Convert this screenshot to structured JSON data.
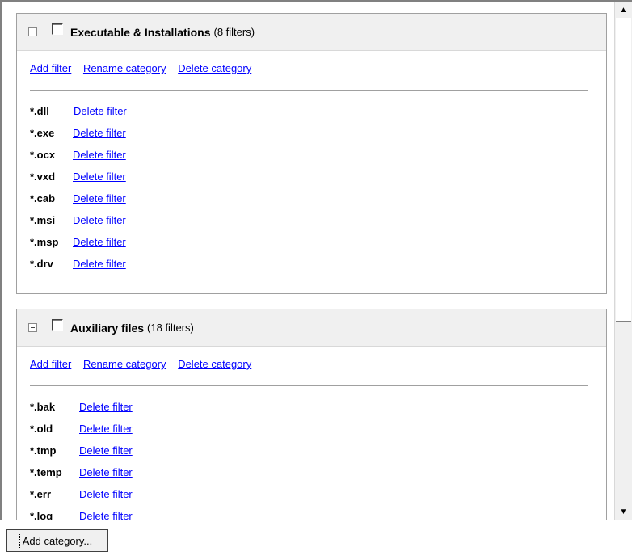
{
  "categories": [
    {
      "title": "Executable & Installations",
      "count": "(8 filters)",
      "actions": {
        "add": "Add filter",
        "rename": "Rename category",
        "delete": "Delete category"
      },
      "filters": [
        {
          "ext": "*.dll",
          "action": "Delete filter"
        },
        {
          "ext": "*.exe",
          "action": "Delete filter"
        },
        {
          "ext": "*.ocx",
          "action": "Delete filter"
        },
        {
          "ext": "*.vxd",
          "action": "Delete filter"
        },
        {
          "ext": "*.cab",
          "action": "Delete filter"
        },
        {
          "ext": "*.msi",
          "action": "Delete filter"
        },
        {
          "ext": "*.msp",
          "action": "Delete filter"
        },
        {
          "ext": "*.drv",
          "action": "Delete filter"
        }
      ]
    },
    {
      "title": "Auxiliary files",
      "count": "(18 filters)",
      "actions": {
        "add": "Add filter",
        "rename": "Rename category",
        "delete": "Delete category"
      },
      "filters": [
        {
          "ext": "*.bak",
          "action": "Delete filter"
        },
        {
          "ext": "*.old",
          "action": "Delete filter"
        },
        {
          "ext": "*.tmp",
          "action": "Delete filter"
        },
        {
          "ext": "*.temp",
          "action": "Delete filter"
        },
        {
          "ext": "*.err",
          "action": "Delete filter"
        },
        {
          "ext": "*.log",
          "action": "Delete filter"
        }
      ]
    }
  ],
  "scrollbar": {
    "up_icon": "▲",
    "down_icon": "▼"
  },
  "footer": {
    "add_category": "Add category..."
  }
}
